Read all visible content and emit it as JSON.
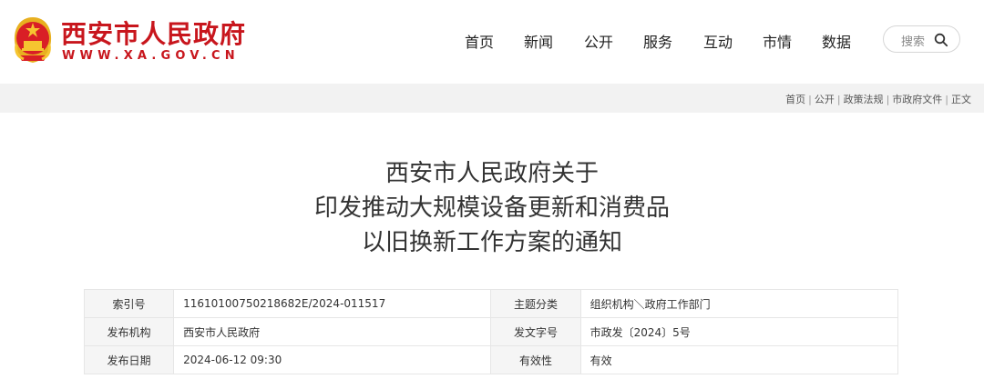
{
  "site": {
    "name": "西安市人民政府",
    "url": "WWW.XA.GOV.CN",
    "brand_color": "#c8161d",
    "emblem_icon": "national-emblem-icon"
  },
  "nav": {
    "items": [
      {
        "label": "首页",
        "name": "nav-home"
      },
      {
        "label": "新闻",
        "name": "nav-news"
      },
      {
        "label": "公开",
        "name": "nav-open"
      },
      {
        "label": "服务",
        "name": "nav-service"
      },
      {
        "label": "互动",
        "name": "nav-interact"
      },
      {
        "label": "市情",
        "name": "nav-city"
      },
      {
        "label": "数据",
        "name": "nav-data"
      }
    ],
    "search_placeholder": "搜索",
    "search_icon": "search-icon"
  },
  "breadcrumb": [
    "首页",
    "公开",
    "政策法规",
    "市政府文件",
    "正文"
  ],
  "article": {
    "title_lines": [
      "西安市人民政府关于",
      "印发推动大规模设备更新和消费品",
      "以旧换新工作方案的通知"
    ]
  },
  "meta": {
    "rows": [
      [
        {
          "k": "索引号",
          "v": "11610100750218682E/2024-011517"
        },
        {
          "k": "主题分类",
          "v": "组织机构＼政府工作部门"
        }
      ],
      [
        {
          "k": "发布机构",
          "v": "西安市人民政府"
        },
        {
          "k": "发文字号",
          "v": "市政发〔2024〕5号"
        }
      ],
      [
        {
          "k": "发布日期",
          "v": "2024-06-12 09:30"
        },
        {
          "k": "有效性",
          "v": "有效"
        }
      ]
    ]
  }
}
